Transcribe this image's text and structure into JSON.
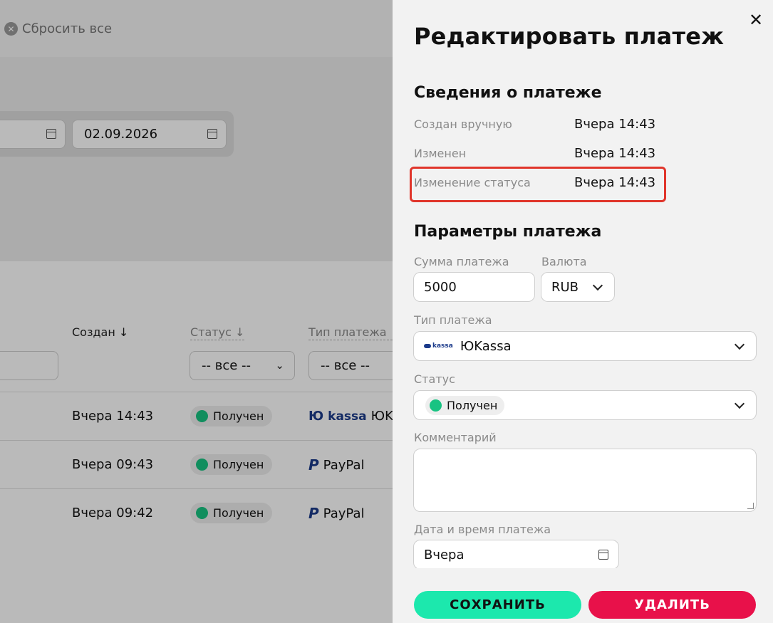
{
  "background": {
    "reset_label": "Сбросить все",
    "date_to": "02.09.2026",
    "columns": {
      "created": "Создан ↓",
      "status": "Статус ↓",
      "payment_type": "Тип платежа ↓"
    },
    "filter_all": "-- все --",
    "rows": [
      {
        "created": "Вчера 14:43",
        "status": "Получен",
        "type": "ЮK",
        "logo": "kassa"
      },
      {
        "created": "Вчера 09:43",
        "status": "Получен",
        "type": "PayPal",
        "logo": "P"
      },
      {
        "created": "Вчера 09:42",
        "status": "Получен",
        "type": "PayPal",
        "logo": "P"
      }
    ]
  },
  "drawer": {
    "title": "Редактировать платеж",
    "info_section": "Сведения о платеже",
    "info": [
      {
        "label": "Создан вручную",
        "value": "Вчера 14:43"
      },
      {
        "label": "Изменен",
        "value": "Вчера 14:43"
      },
      {
        "label": "Изменение статуса",
        "value": "Вчера 14:43"
      }
    ],
    "params_section": "Параметры платежа",
    "amount_label": "Сумма платежа",
    "amount_value": "5000",
    "currency_label": "Валюта",
    "currency_value": "RUB",
    "type_label": "Тип платежа",
    "type_value": "ЮKassa",
    "status_label": "Статус",
    "status_value": "Получен",
    "comment_label": "Комментарий",
    "comment_value": "",
    "datetime_label": "Дата и время платежа",
    "datetime_value": "Вчера",
    "save_label": "СОХРАНИТЬ",
    "delete_label": "УДАЛИТЬ"
  },
  "colors": {
    "accent_save": "#1ce8ad",
    "accent_delete": "#e8114a",
    "status_ok": "#18c382",
    "highlight": "#e0352b"
  }
}
